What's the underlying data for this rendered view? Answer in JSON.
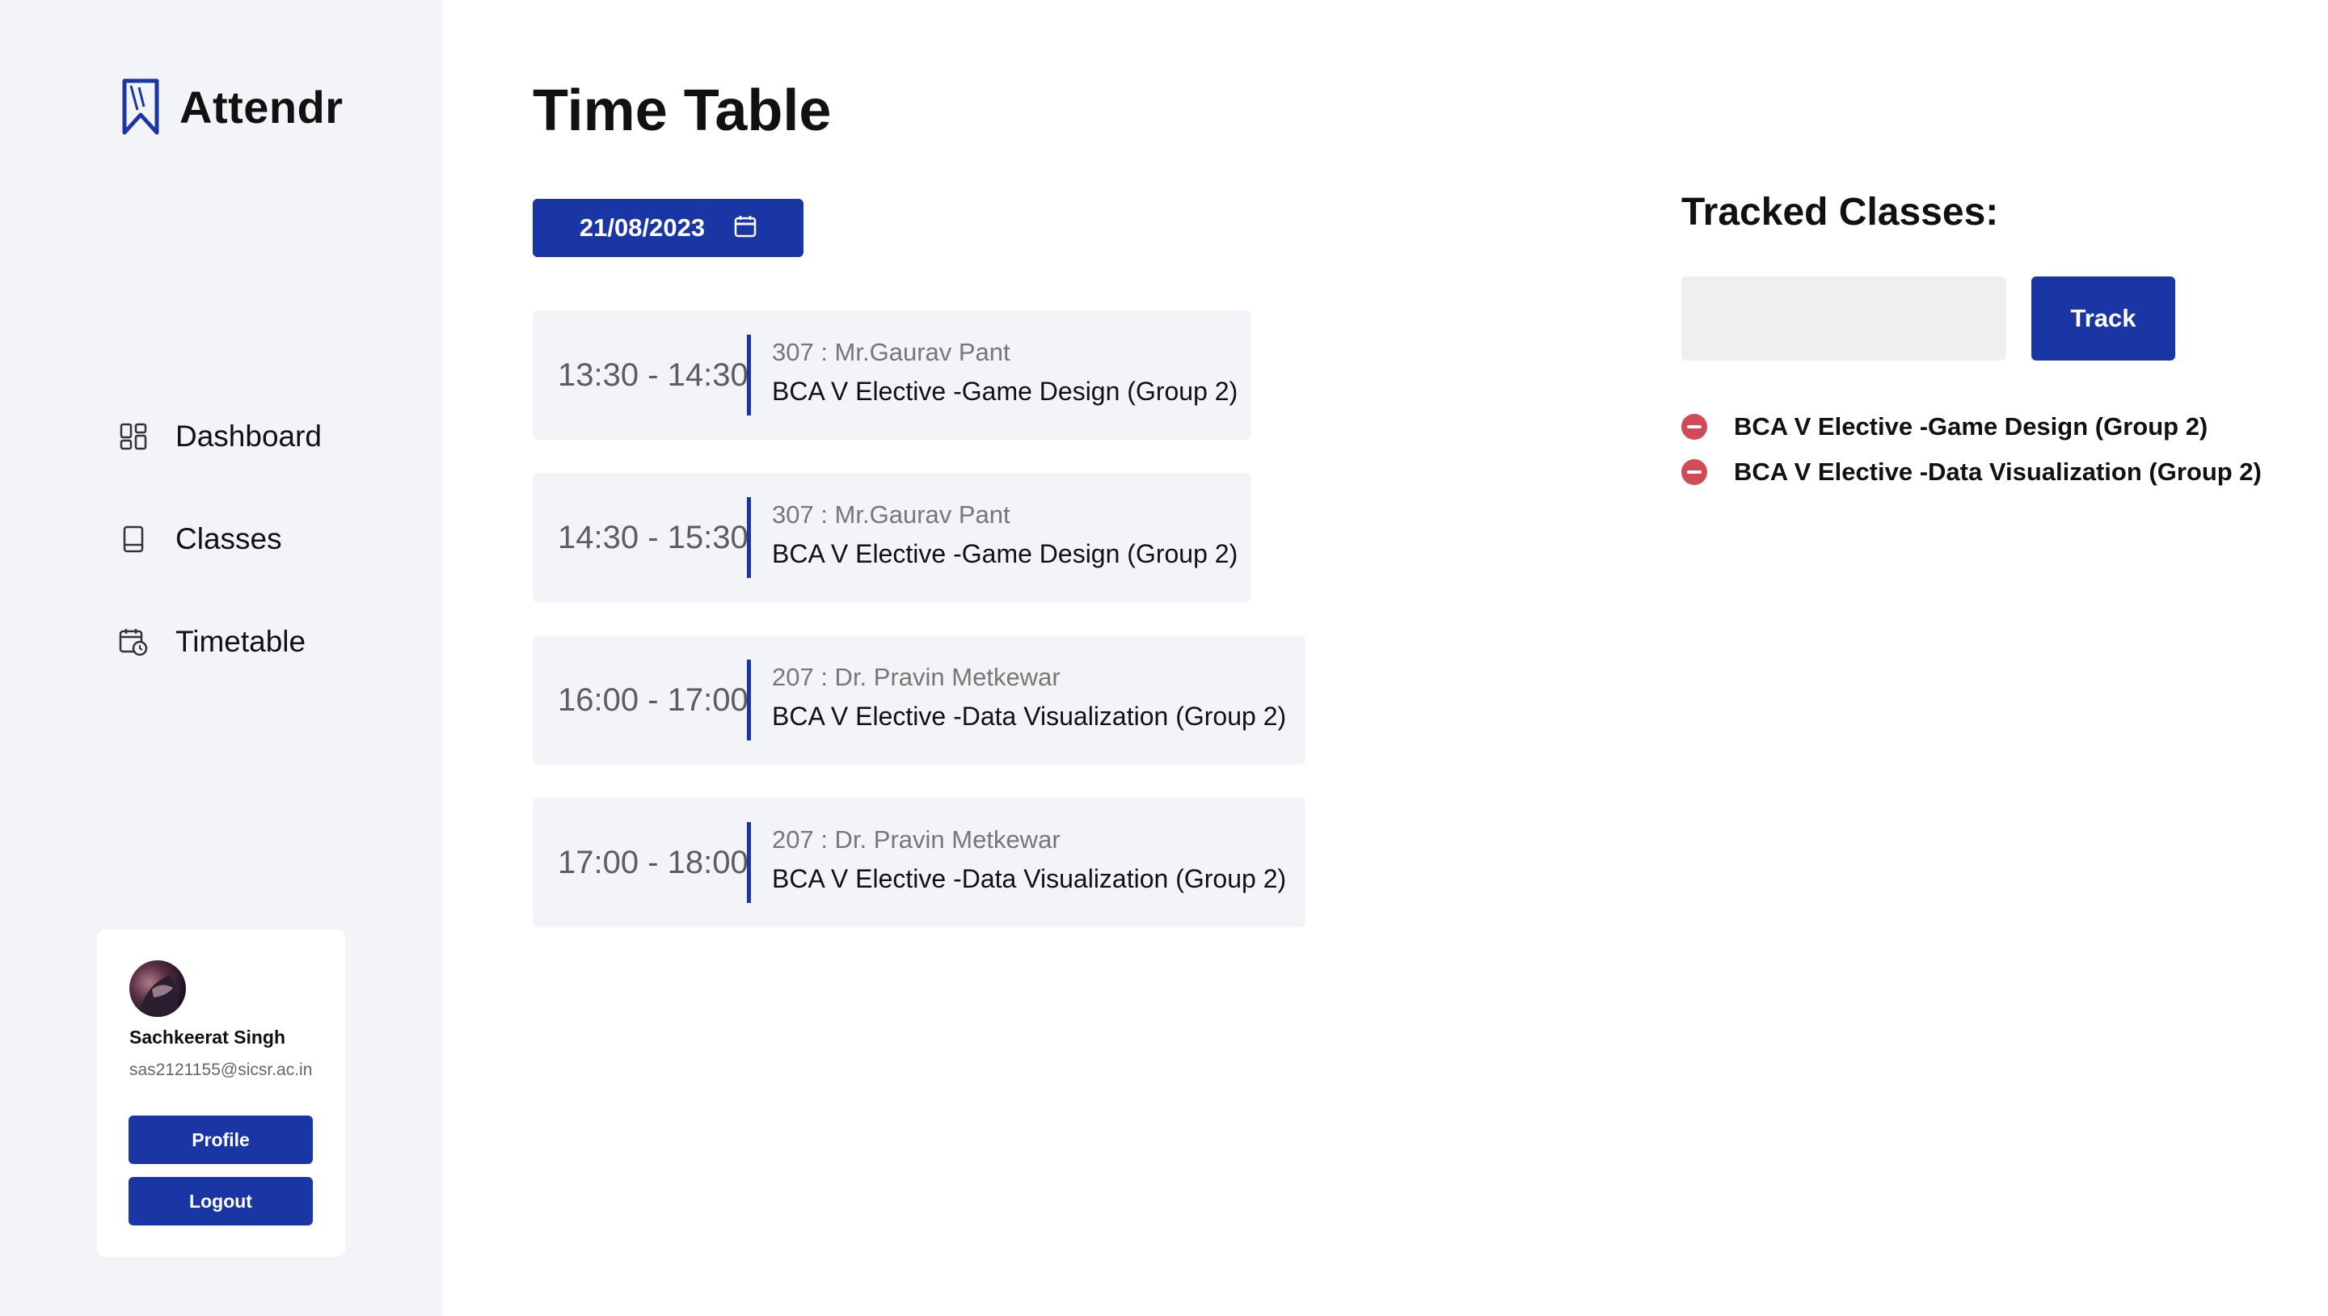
{
  "app": {
    "name": "Attendr"
  },
  "sidebar": {
    "items": [
      {
        "label": "Dashboard",
        "icon": "dashboard-icon"
      },
      {
        "label": "Classes",
        "icon": "book-icon"
      },
      {
        "label": "Timetable",
        "icon": "calendar-clock-icon"
      }
    ]
  },
  "user": {
    "name": "Sachkeerat Singh",
    "email": "sas2121155@sicsr.ac.in",
    "profile_label": "Profile",
    "logout_label": "Logout"
  },
  "main": {
    "title": "Time Table",
    "date": "21/08/2023",
    "slots": [
      {
        "time": "13:30 - 14:30",
        "room": "307 : Mr.Gaurav Pant",
        "course": "BCA V Elective -Game Design (Group 2)"
      },
      {
        "time": "14:30 - 15:30",
        "room": "307 : Mr.Gaurav Pant",
        "course": "BCA V Elective -Game Design (Group 2)"
      },
      {
        "time": "16:00 - 17:00",
        "room": "207 : Dr. Pravin Metkewar",
        "course": "BCA V Elective -Data Visualization (Group 2)"
      },
      {
        "time": "17:00 - 18:00",
        "room": "207 : Dr. Pravin Metkewar",
        "course": "BCA V Elective -Data Visualization (Group 2)"
      }
    ]
  },
  "tracked": {
    "title": "Tracked Classes:",
    "input_value": "",
    "button_label": "Track",
    "items": [
      "BCA V Elective -Game Design (Group 2)",
      "BCA V Elective -Data Visualization (Group 2)"
    ]
  },
  "colors": {
    "accent": "#1a36a4",
    "sidebar_bg": "#f3f4f8",
    "remove": "#d04a58"
  }
}
